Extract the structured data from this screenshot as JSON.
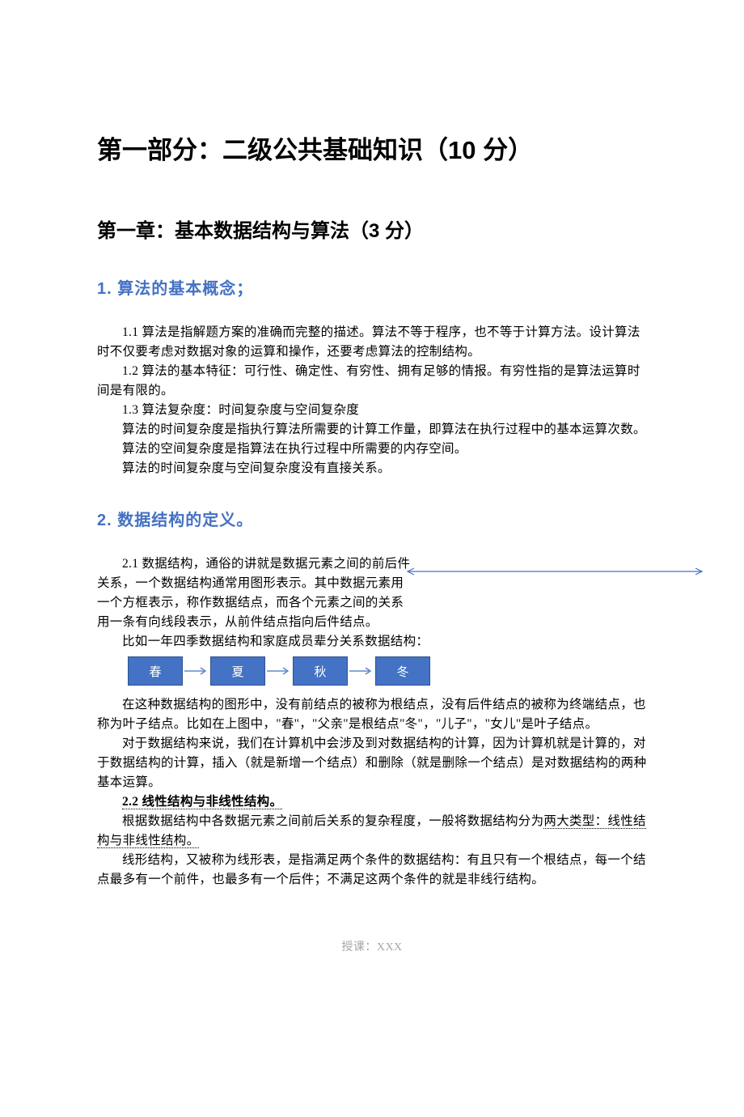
{
  "h1": "第一部分：二级公共基础知识（10 分）",
  "h2": "第一章：基本数据结构与算法（3 分）",
  "sec1": {
    "heading": "1.  算法的基本概念；",
    "p1": "1.1 算法是指解题方案的准确而完整的描述。算法不等于程序，也不等于计算方法。设计算法时不仅要考虑对数据对象的运算和操作，还要考虑算法的控制结构。",
    "p2": "1.2 算法的基本特征：可行性、确定性、有穷性、拥有足够的情报。有穷性指的是算法运算时间是有限的。",
    "p3": "1.3 算法复杂度：时间复杂度与空间复杂度",
    "p4": "算法的时间复杂度是指执行算法所需要的计算工作量，即算法在执行过程中的基本运算次数。",
    "p5": "算法的空间复杂度是指算法在执行过程中所需要的内存空间。",
    "p6": "算法的时间复杂度与空间复杂度没有直接关系。"
  },
  "sec2": {
    "heading": "2.  数据结构的定义。",
    "p1_lead": "2.1 数据结构，通俗的讲就是数据元素之间的前后件关系，一个数据结构通常用图形表示。其中数据元素用一个方框表示，称作数据结点，而各个元素之间的关系用一条有向线段表示，从前件结点指向后件结点。",
    "p2": "比如一年四季数据结构和家庭成员辈分关系数据结构：",
    "nodes": [
      "春",
      "夏",
      "秋",
      "冬"
    ],
    "p3": "在这种数据结构的图形中，没有前结点的被称为根结点，没有后件结点的被称为终端结点，也称为叶子结点。比如在上图中，\"春\"，\"父亲\"是根结点\"冬\"，\"儿子\"，\"女儿\"是叶子结点。",
    "p4": "对于数据结构来说，我们在计算机中会涉及到对数据结构的计算，因为计算机就是计算的，对于数据结构的计算，插入（就是新增一个结点）和删除（就是删除一个结点）是对数据结构的两种基本运算。",
    "p5_title": "2.2 线性结构与非线性结构。",
    "p6a": "根据数据结构中各数据元素之间前后关系的复杂程度，一般将数据结构分为",
    "p6b": "两大类型：线性结构与非线性结构。",
    "p7": "线形结构，又被称为线形表，是指满足两个条件的数据结构：有且只有一个根结点，每一个结点最多有一个前件，也最多有一个后件；不满足这两个条件的就是非线行结构。"
  },
  "footer": "授课：XXX"
}
